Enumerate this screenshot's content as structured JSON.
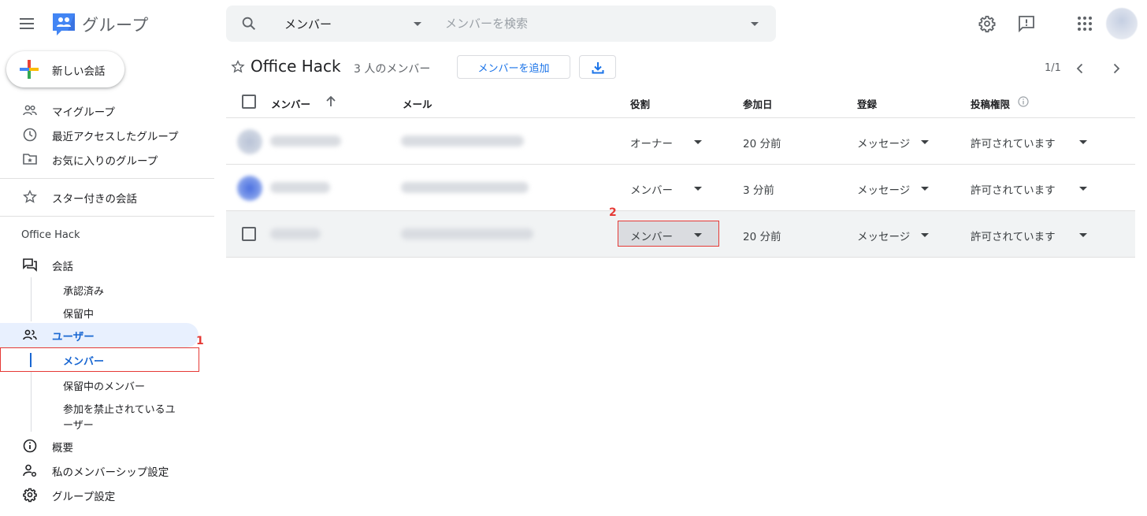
{
  "app": {
    "title": "グループ"
  },
  "search": {
    "scope": "メンバー",
    "placeholder": "メンバーを検索"
  },
  "sidebar": {
    "new_conversation": "新しい会話",
    "top_items": [
      {
        "label": "マイグループ",
        "icon": "people-icon"
      },
      {
        "label": "最近アクセスしたグループ",
        "icon": "clock-icon"
      },
      {
        "label": "お気に入りのグループ",
        "icon": "folder-star-icon"
      }
    ],
    "starred": "スター付きの会話",
    "group_section": "Office Hack",
    "conversations": "会話",
    "conversation_sub": [
      "承認済み",
      "保留中"
    ],
    "users": "ユーザー",
    "users_sub": [
      "メンバー",
      "保留中のメンバー",
      "参加を禁止されているユ",
      "ーザー"
    ],
    "about": "概要",
    "my_membership": "私のメンバーシップ設定",
    "group_settings": "グループ設定"
  },
  "callouts": {
    "first": "1",
    "second": "2"
  },
  "main": {
    "group_name": "Office Hack",
    "member_count": "3 人のメンバー",
    "add_member": "メンバーを追加",
    "pager": "1/1",
    "columns": {
      "member": "メンバー",
      "email": "メール",
      "role": "役割",
      "joined": "参加日",
      "subscription": "登録",
      "posting": "投稿権限"
    },
    "rows": [
      {
        "role": "オーナー",
        "joined": "20 分前",
        "subscription": "メッセージ",
        "posting": "許可されています"
      },
      {
        "role": "メンバー",
        "joined": "3 分前",
        "subscription": "メッセージ",
        "posting": "許可されています"
      },
      {
        "role": "メンバー",
        "joined": "20 分前",
        "subscription": "メッセージ",
        "posting": "許可されています"
      }
    ]
  },
  "colors": {
    "accent": "#1a73e8",
    "active_bg": "#e8f0fe",
    "highlight_red": "#e53935"
  }
}
